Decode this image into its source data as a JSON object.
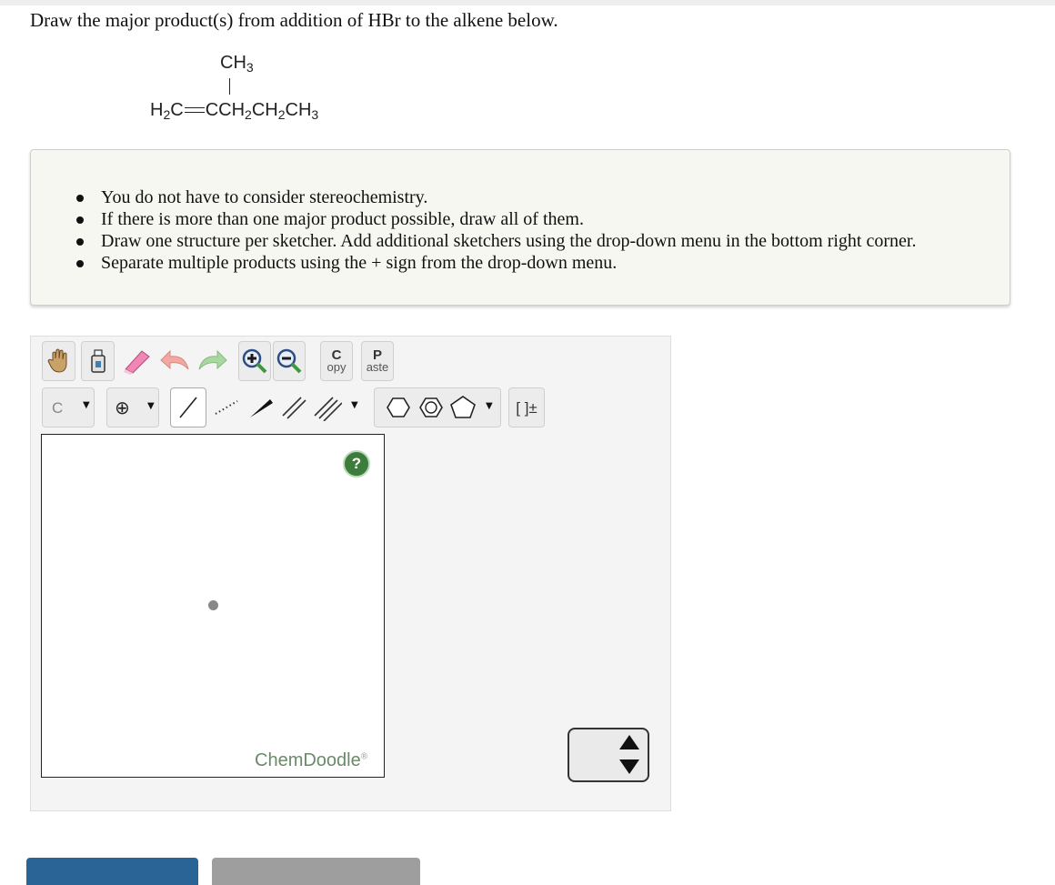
{
  "question": "Draw the major product(s) from addition of HBr to the alkene below.",
  "structure": {
    "top_group": "CH",
    "top_sub": "3",
    "chain": {
      "h": "H",
      "h_sub": "2",
      "c1": "C",
      "c2": "CCH",
      "s1": "2",
      "c3": "CH",
      "s2": "2",
      "c4": "CH",
      "s3": "3"
    }
  },
  "hints": [
    "You do not have to consider stereochemistry.",
    "If there is more than one major product possible, draw all of them.",
    "Draw one structure per sketcher. Add additional sketchers using the drop-down menu in the bottom right corner.",
    "Separate multiple products using the + sign from the drop-down menu."
  ],
  "toolbar": {
    "copy_top": "C",
    "copy_bottom": "opy",
    "paste_top": "P",
    "paste_bottom": "aste",
    "atom_label": "C",
    "charge_label": "⊕",
    "bracket_label": "[ ]±"
  },
  "canvas": {
    "help_label": "?",
    "brand": "ChemDoodle",
    "brand_mark": "®"
  },
  "colors": {
    "accent_blue": "#2a6496",
    "help_green": "#3d7d3b",
    "hint_bg": "#f7f7f1"
  }
}
